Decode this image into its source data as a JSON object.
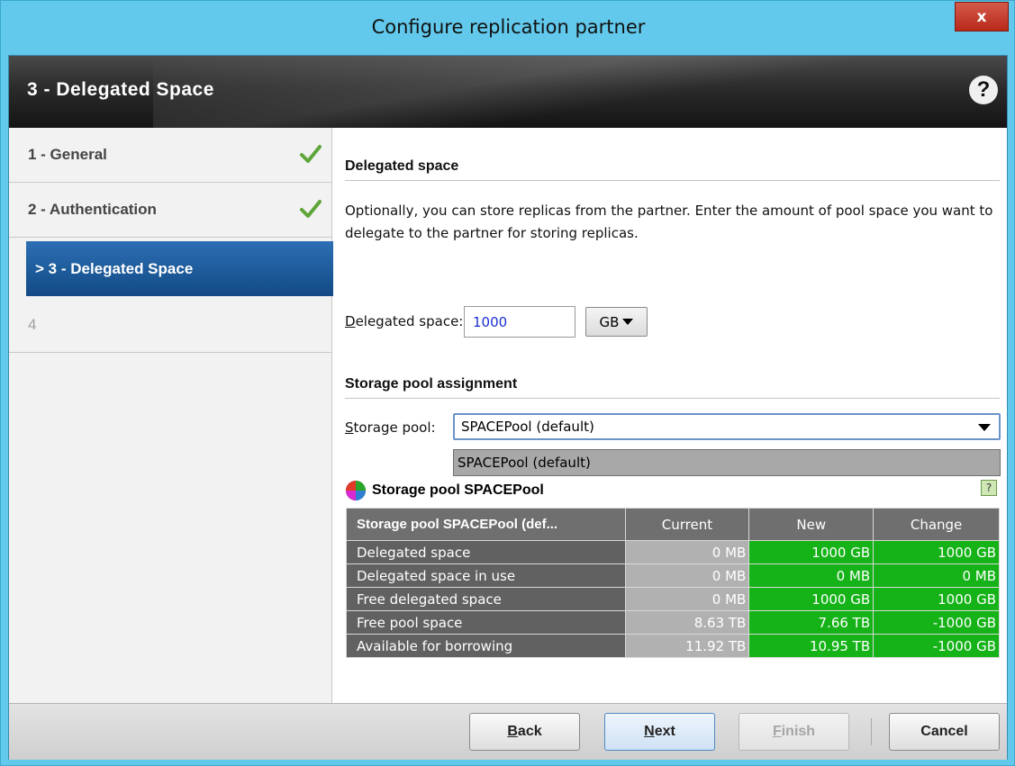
{
  "window": {
    "title": "Configure replication partner",
    "close_label": "x"
  },
  "banner": {
    "title": "3 - Delegated Space",
    "help_label": "?"
  },
  "steps": [
    {
      "label": "1 - General",
      "state": "done"
    },
    {
      "label": "2 - Authentication",
      "state": "done"
    },
    {
      "label": "> 3 - Delegated Space",
      "state": "active"
    },
    {
      "label": "4",
      "state": "disabled"
    }
  ],
  "delegated": {
    "heading": "Delegated space",
    "description": "Optionally, you can store replicas from the partner. Enter the amount of pool space you want to delegate to the partner for storing replicas.",
    "field_label_first": "D",
    "field_label_rest": "elegated space:",
    "value": "1000",
    "unit": "GB"
  },
  "storage": {
    "heading": "Storage pool assignment",
    "label_first": "S",
    "label_rest": "torage pool:",
    "selected": "SPACEPool (default)",
    "dropdown_option": "SPACEPool (default)",
    "pool_title": "Storage pool SPACEPool"
  },
  "table": {
    "headers": [
      "Storage pool SPACEPool (def...",
      "Current",
      "New",
      "Change"
    ],
    "rows": [
      {
        "label": "Delegated space",
        "current": "0 MB",
        "new": "1000 GB",
        "change": "1000 GB"
      },
      {
        "label": "Delegated space in use",
        "current": "0 MB",
        "new": "0 MB",
        "change": "0 MB"
      },
      {
        "label": "Free delegated space",
        "current": "0 MB",
        "new": "1000 GB",
        "change": "1000 GB"
      },
      {
        "label": "Free pool space",
        "current": "8.63 TB",
        "new": "7.66 TB",
        "change": "-1000 GB"
      },
      {
        "label": "Available for borrowing",
        "current": "11.92 TB",
        "new": "10.95 TB",
        "change": "-1000 GB"
      }
    ]
  },
  "footer": {
    "back_first": "B",
    "back_rest": "ack",
    "next_first": "N",
    "next_rest": "ext",
    "finish_first": "F",
    "finish_rest": "inish",
    "cancel": "Cancel"
  },
  "colors": {
    "accent": "#124a85",
    "highlight": "#16b318",
    "frame": "#62c9ec"
  }
}
